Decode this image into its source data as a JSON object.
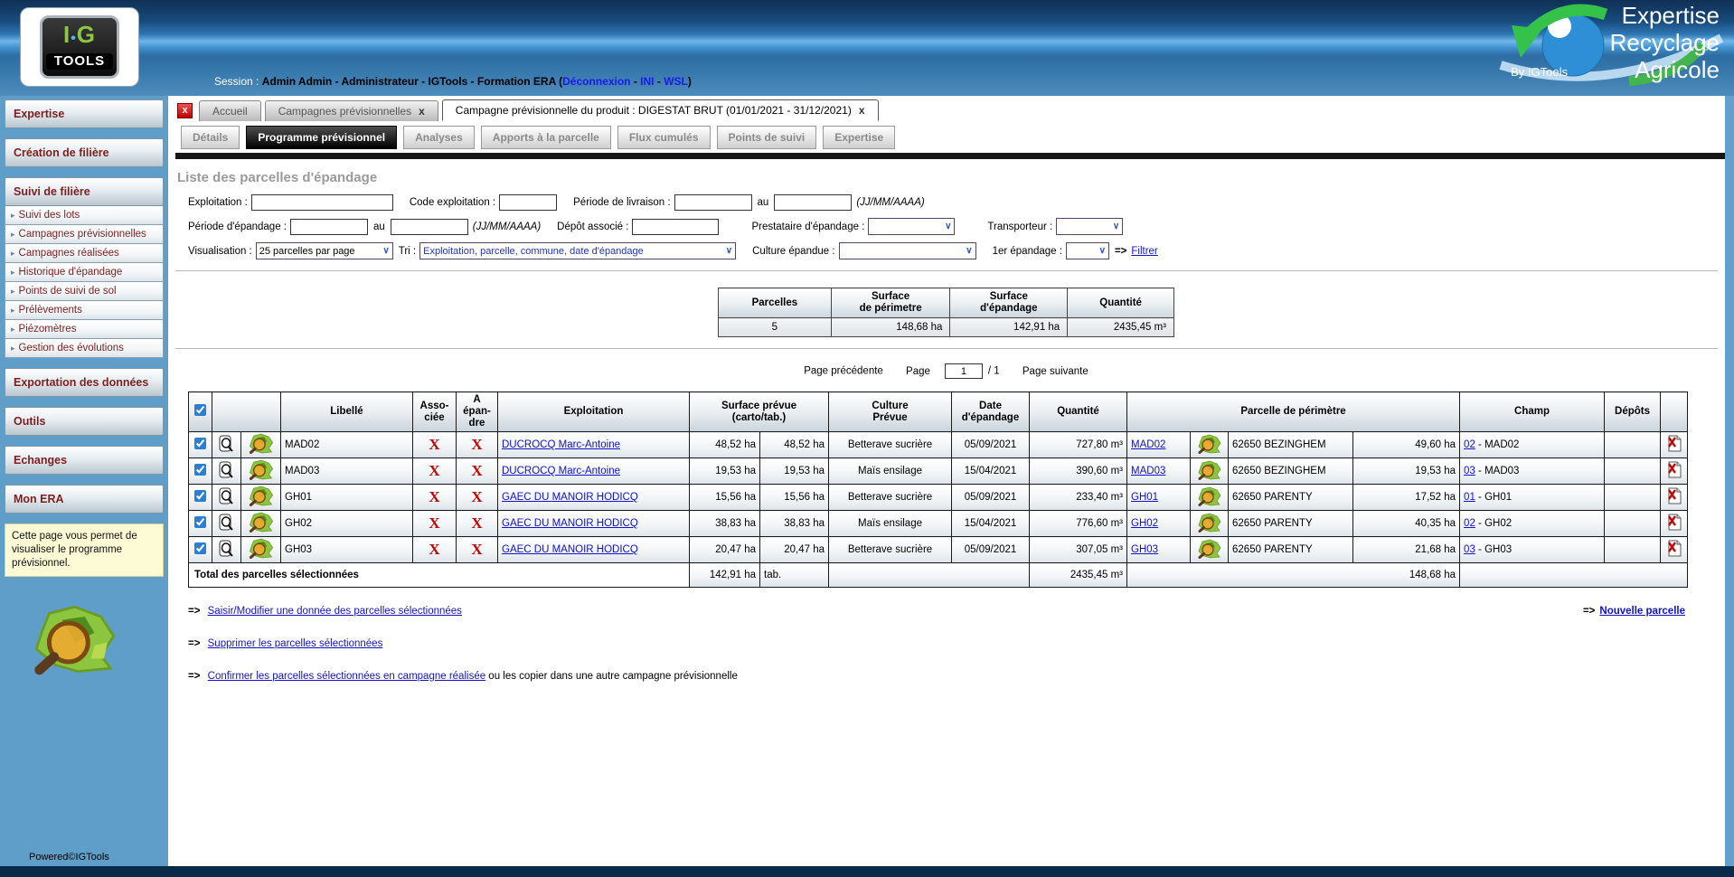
{
  "colors": {
    "header_blue": "#2d6da2",
    "sidebar_blue": "#5f9ec9",
    "link_blue": "#1212cc",
    "maroon_text": "#7b1f1f",
    "red_x": "#c00808",
    "active_tab_black": "#161616",
    "logo_green": "#8dc63f",
    "footer_navy": "#0a2a4a"
  },
  "header": {
    "logo_top": "I",
    "logo_dot": "•",
    "logo_top2": "G",
    "logo_bottom": "TOOLS",
    "session_label": "Session :",
    "session_user": "Admin Admin - Administrateur - IGTools - Formation ERA (",
    "link_deconnexion": "Déconnexion",
    "sep1": " - ",
    "link_ini": "INI",
    "sep2": " - ",
    "link_wsl": "WSL",
    "session_close": ")",
    "brand_line1": "Expertise",
    "brand_line2": "Recyclage",
    "brand_line3": "Agricole",
    "brand_by": "By IGTools"
  },
  "sidebar": {
    "expertise": "Expertise",
    "creation": "Création de filière",
    "suivi": "Suivi de filière",
    "items": [
      "Suivi des lots",
      "Campagnes prévisionnelles",
      "Campagnes réalisées",
      "Historique d'épandage",
      "Points de suivi de sol",
      "Prélèvements",
      "Piézomètres",
      "Gestion des évolutions"
    ],
    "exportation": "Exportation des données",
    "outils": "Outils",
    "echanges": "Echanges",
    "mon_era": "Mon ERA",
    "info": "Cette page vous permet de visualiser le programme prévisionnel.",
    "powered": "Powered©IGTools"
  },
  "tabs": {
    "close_all": "x",
    "accueil": "Accueil",
    "campagnes": "Campagnes prévisionnelles",
    "campagnes_x": "x",
    "active": "Campagne prévisionnelle du produit : DIGESTAT BRUT (01/01/2021 - 31/12/2021)",
    "active_x": "x"
  },
  "subtabs": [
    "Détails",
    "Programme prévisionnel",
    "Analyses",
    "Apports à la parcelle",
    "Flux cumulés",
    "Points de suivi",
    "Expertise"
  ],
  "filters": {
    "title": "Liste des parcelles d'épandage",
    "exploitation_label": "Exploitation :",
    "code_exploitation_label": "Code exploitation :",
    "periode_livraison_label": "Période de livraison :",
    "au": "au",
    "date_format": "(JJ/MM/AAAA)",
    "periode_epandage_label": "Période d'épandage :",
    "depot_label": "Dépôt associé :",
    "prestataire_label": "Prestataire d'épandage :",
    "transporteur_label": "Transporteur :",
    "visualisation_label": "Visualisation :",
    "visualisation_value": "25 parcelles par page",
    "tri_label": "Tri :",
    "tri_value": "Exploitation, parcelle, commune, date d'épandage",
    "culture_label": "Culture épandue :",
    "premier_epandage_label": "1er épandage :",
    "arrow": "=>",
    "filtrer": "Filtrer"
  },
  "summary": {
    "col1": "Parcelles",
    "col2a": "Surface",
    "col2b": "de périmetre",
    "col3a": "Surface",
    "col3b": "d'épandage",
    "col4": "Quantité",
    "parcelles": "5",
    "surface_perimetre": "148,68 ha",
    "surface_epandage": "142,91 ha",
    "quantite": "2435,45 m³"
  },
  "pagination": {
    "prev": "Page précédente",
    "page_label": "Page",
    "page_value": "1",
    "of": "/ 1",
    "next": "Page suivante"
  },
  "table": {
    "headers": {
      "libelle": "Libellé",
      "assoc1": "Asso-",
      "assoc2": "ciée",
      "aep1": "A",
      "aep2": "épan-",
      "aep3": "dre",
      "exploitation": "Exploitation",
      "surface1": "Surface prévue",
      "surface2": "(carto/tab.)",
      "culture1": "Culture",
      "culture2": "Prévue",
      "date1": "Date",
      "date2": "d'épandage",
      "quantite": "Quantité",
      "parcelle": "Parcelle de périmètre",
      "champ": "Champ",
      "depots": "Dépôts"
    },
    "x_mark": "X",
    "rows": [
      {
        "libelle": "MAD02",
        "exploitation": "DUCROCQ Marc-Antoine",
        "surface_carto": "48,52 ha",
        "surface_tab": "48,52 ha",
        "culture": "Betterave sucrière",
        "date": "05/09/2021",
        "quantite": "727,80 m³",
        "parcelle": "MAD02",
        "commune": "62650 BEZINGHEM",
        "surface_perimetre": "49,60 ha",
        "champ_num": "02",
        "champ_rest": " - MAD02"
      },
      {
        "libelle": "MAD03",
        "exploitation": "DUCROCQ Marc-Antoine",
        "surface_carto": "19,53 ha",
        "surface_tab": "19,53 ha",
        "culture": "Maïs ensilage",
        "date": "15/04/2021",
        "quantite": "390,60 m³",
        "parcelle": "MAD03",
        "commune": "62650 BEZINGHEM",
        "surface_perimetre": "19,53 ha",
        "champ_num": "03",
        "champ_rest": " - MAD03"
      },
      {
        "libelle": "GH01",
        "exploitation": "GAEC DU MANOIR HODICQ",
        "surface_carto": "15,56 ha",
        "surface_tab": "15,56 ha",
        "culture": "Betterave sucrière",
        "date": "05/09/2021",
        "quantite": "233,40 m³",
        "parcelle": "GH01",
        "commune": "62650 PARENTY",
        "surface_perimetre": "17,52 ha",
        "champ_num": "01",
        "champ_rest": " - GH01"
      },
      {
        "libelle": "GH02",
        "exploitation": "GAEC DU MANOIR HODICQ",
        "surface_carto": "38,83 ha",
        "surface_tab": "38,83 ha",
        "culture": "Maïs ensilage",
        "date": "15/04/2021",
        "quantite": "776,60 m³",
        "parcelle": "GH02",
        "commune": "62650 PARENTY",
        "surface_perimetre": "40,35 ha",
        "champ_num": "02",
        "champ_rest": " - GH02"
      },
      {
        "libelle": "GH03",
        "exploitation": "GAEC DU MANOIR HODICQ",
        "surface_carto": "20,47 ha",
        "surface_tab": "20,47 ha",
        "culture": "Betterave sucrière",
        "date": "05/09/2021",
        "quantite": "307,05 m³",
        "parcelle": "GH03",
        "commune": "62650 PARENTY",
        "surface_perimetre": "21,68 ha",
        "champ_num": "03",
        "champ_rest": " - GH03"
      }
    ],
    "total_label": "Total des parcelles sélectionnées",
    "total_surface": "142,91 ha",
    "total_tab": "tab.",
    "total_quantite": "2435,45 m³",
    "total_perimetre": "148,68 ha"
  },
  "actions": {
    "arrow": "=>",
    "modify": "Saisir/Modifier une donnée des parcelles sélectionnées",
    "delete": "Supprimer les parcelles sélectionnées",
    "confirm_link": "Confirmer les parcelles sélectionnées en campagne réalisée",
    "confirm_rest": " ou les copier dans une autre campagne prévisionnelle",
    "new_parcel": "Nouvelle parcelle"
  }
}
